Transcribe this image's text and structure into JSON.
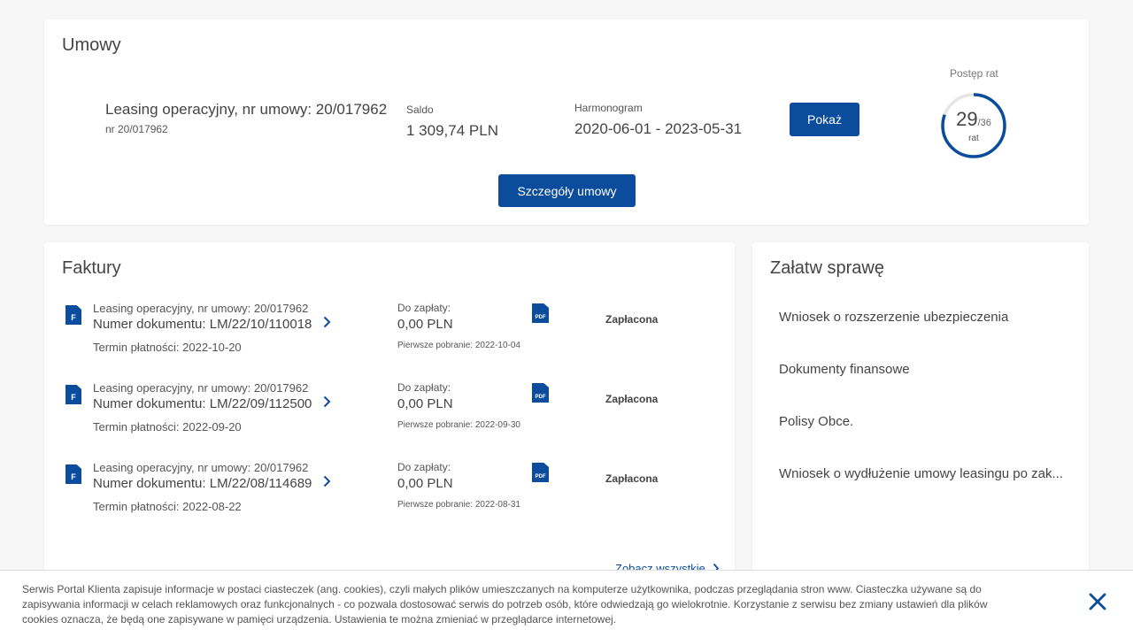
{
  "umowy": {
    "title": "Umowy",
    "contract_name": "Leasing operacyjny, nr umowy: 20/017962",
    "contract_nr": "nr 20/017962",
    "saldo_label": "Saldo",
    "saldo_value": "1 309,74 PLN",
    "harmonogram_label": "Harmonogram",
    "harmonogram_value": "2020-06-01 - 2023-05-31",
    "show_button": "Pokaż",
    "details_button": "Szczegóły umowy",
    "progress": {
      "title": "Postęp rat",
      "paid": "29",
      "total": "/36",
      "unit": "rat",
      "fraction": 0.806
    }
  },
  "faktury": {
    "title": "Faktury",
    "pay_label": "Do zapłaty:",
    "invoices": [
      {
        "icon_letter": "F",
        "contract": "Leasing operacyjny, nr umowy: 20/017962",
        "doc": "Numer dokumentu: LM/22/10/110018",
        "term": "Termin płatności: 2022-10-20",
        "amount": "0,00 PLN",
        "first_download": "Pierwsze pobranie: 2022-10-04",
        "pdf": "PDF",
        "status": "Zapłacona"
      },
      {
        "icon_letter": "F",
        "contract": "Leasing operacyjny, nr umowy: 20/017962",
        "doc": "Numer dokumentu: LM/22/09/112500",
        "term": "Termin płatności: 2022-09-20",
        "amount": "0,00 PLN",
        "first_download": "Pierwsze pobranie: 2022-09-30",
        "pdf": "PDF",
        "status": "Zapłacona"
      },
      {
        "icon_letter": "F",
        "contract": "Leasing operacyjny, nr umowy: 20/017962",
        "doc": "Numer dokumentu: LM/22/08/114689",
        "term": "Termin płatności: 2022-08-22",
        "amount": "0,00 PLN",
        "first_download": "Pierwsze pobranie: 2022-08-31",
        "pdf": "PDF",
        "status": "Zapłacona"
      }
    ],
    "see_all": "Zobacz wszystkie"
  },
  "zalatw": {
    "title": "Załatw sprawę",
    "items": [
      "Wniosek o rozszerzenie ubezpieczenia",
      "Dokumenty finansowe",
      "Polisy Obce.",
      "Wniosek o wydłużenie umowy leasingu po zak..."
    ]
  },
  "cookie": {
    "text": "Serwis Portal Klienta zapisuje informacje w postaci ciasteczek (ang. cookies), czyli małych plików umieszczanych na komputerze użytkownika, podczas przeglądania stron www. Ciasteczka używane są do zapisywania informacji w celach reklamowych oraz funkcjonalnych - co pozwala dostosować serwis do potrzeb osób, które odwiedzają go wielokrotnie. Korzystanie z serwisu bez zmiany ustawień dla plików cookies oznacza, że będą one zapisywane w pamięci urządzenia. Ustawienia te można zmieniać w przeglądarce internetowej."
  },
  "colors": {
    "accent": "#0b4c9c",
    "background": "#f7f7f7",
    "card": "#ffffff"
  }
}
